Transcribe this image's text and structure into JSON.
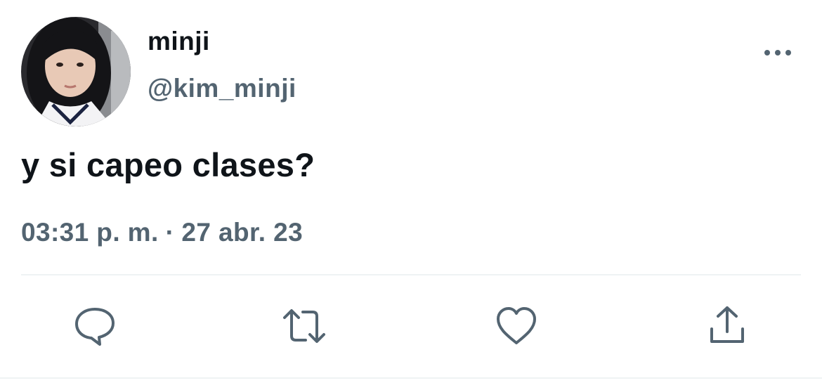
{
  "tweet": {
    "display_name": "minji",
    "handle": "@kim_minji",
    "text": "y si capeo clases?",
    "time": "03:31 p. m.",
    "separator": "·",
    "date": "27 abr. 23"
  },
  "icons": {
    "avatar": "profile-photo",
    "more": "more-options-icon",
    "reply": "reply-icon",
    "retweet": "retweet-icon",
    "like": "heart-icon",
    "share": "share-icon"
  },
  "colors": {
    "text_primary": "#0f1419",
    "text_secondary": "#536471",
    "divider": "#eff3f4"
  }
}
